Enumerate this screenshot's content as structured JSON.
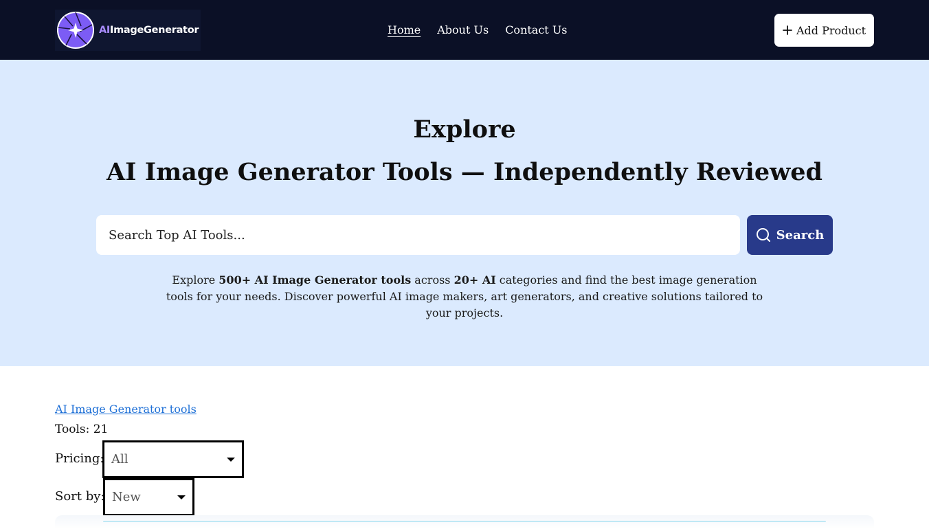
{
  "header": {
    "logo": {
      "prefix": "AI",
      "name": "ImageGenerator"
    },
    "nav": [
      {
        "label": "Home",
        "active": true
      },
      {
        "label": "About Us",
        "active": false
      },
      {
        "label": "Contact Us",
        "active": false
      }
    ],
    "add_product_label": "Add Product"
  },
  "hero": {
    "title_line1": "Explore",
    "title_line2": "AI Image Generator Tools — Independently Reviewed",
    "search": {
      "placeholder": "Search Top AI Tools...",
      "value": "",
      "button_label": "Search"
    },
    "description": {
      "p1": "Explore ",
      "b1": "500+ AI Image Generator tools",
      "p2": " across ",
      "b2": "20+ AI",
      "p3": " categories and find the best image generation tools for your needs. Discover powerful AI image makers, art generators, and creative solutions tailored to your projects."
    }
  },
  "listing": {
    "category_link": "AI Image Generator tools",
    "tools_count_label": "Tools: 21",
    "pricing_label": "Pricing:",
    "pricing_value": "All",
    "sort_label": "Sort by:",
    "sort_value": "New"
  },
  "colors": {
    "header_bg": "#0b1026",
    "hero_bg": "#dbeafe",
    "search_button": "#283a8a",
    "link": "#1d6fd6",
    "logo_accent": "#7c5cf5"
  },
  "icons": {
    "logo": "aperture-sparkle-icon",
    "add": "plus-icon",
    "search": "search-icon",
    "dropdown": "caret-down-icon"
  }
}
